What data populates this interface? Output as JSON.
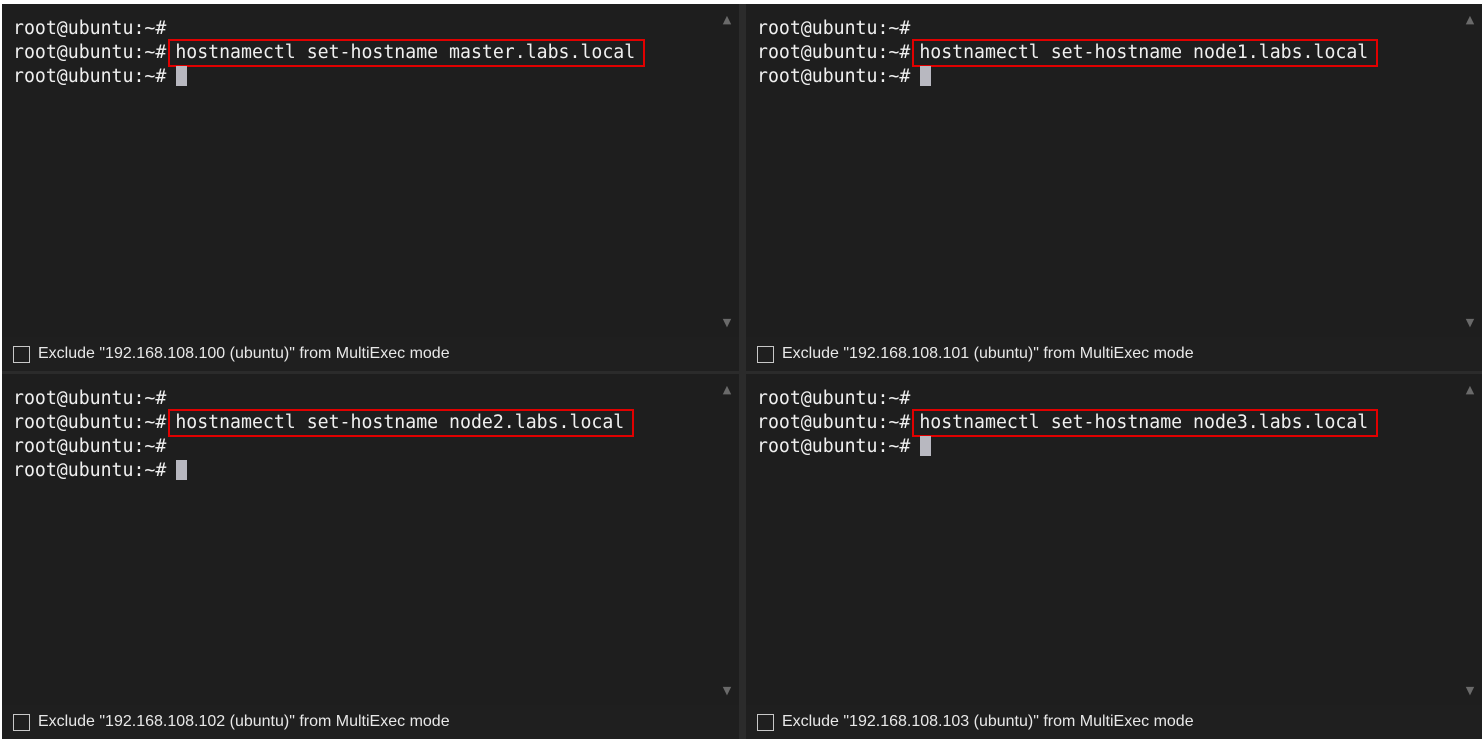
{
  "panes": [
    {
      "lines": [
        {
          "prompt": "root@ubuntu:~#",
          "command": ""
        },
        {
          "prompt": "root@ubuntu:~#",
          "command": "hostnamectl set-hostname master.labs.local"
        },
        {
          "prompt": "root@ubuntu:~#",
          "command": ""
        }
      ],
      "exclude_label": "Exclude \"192.168.108.100 (ubuntu)\" from MultiExec mode",
      "exclude_checked": false
    },
    {
      "lines": [
        {
          "prompt": "root@ubuntu:~#",
          "command": ""
        },
        {
          "prompt": "root@ubuntu:~#",
          "command": "hostnamectl set-hostname node1.labs.local"
        },
        {
          "prompt": "root@ubuntu:~#",
          "command": ""
        }
      ],
      "exclude_label": "Exclude \"192.168.108.101 (ubuntu)\" from MultiExec mode",
      "exclude_checked": false
    },
    {
      "lines": [
        {
          "prompt": "root@ubuntu:~#",
          "command": ""
        },
        {
          "prompt": "root@ubuntu:~#",
          "command": "hostnamectl set-hostname node2.labs.local"
        },
        {
          "prompt": "root@ubuntu:~#",
          "command": ""
        },
        {
          "prompt": "root@ubuntu:~#",
          "command": ""
        }
      ],
      "exclude_label": "Exclude \"192.168.108.102 (ubuntu)\" from MultiExec mode",
      "exclude_checked": false
    },
    {
      "lines": [
        {
          "prompt": "root@ubuntu:~#",
          "command": ""
        },
        {
          "prompt": "root@ubuntu:~#",
          "command": "hostnamectl set-hostname node3.labs.local"
        },
        {
          "prompt": "root@ubuntu:~#",
          "command": ""
        }
      ],
      "exclude_label": "Exclude \"192.168.108.103 (ubuntu)\" from MultiExec mode",
      "exclude_checked": false
    }
  ],
  "icons": {
    "scroll_up": "scroll-up-arrow-icon",
    "scroll_down": "scroll-down-arrow-icon"
  },
  "colors": {
    "terminal_bg": "#1e1e1e",
    "highlight_border": "#e10000",
    "text": "#f0f0f0"
  }
}
